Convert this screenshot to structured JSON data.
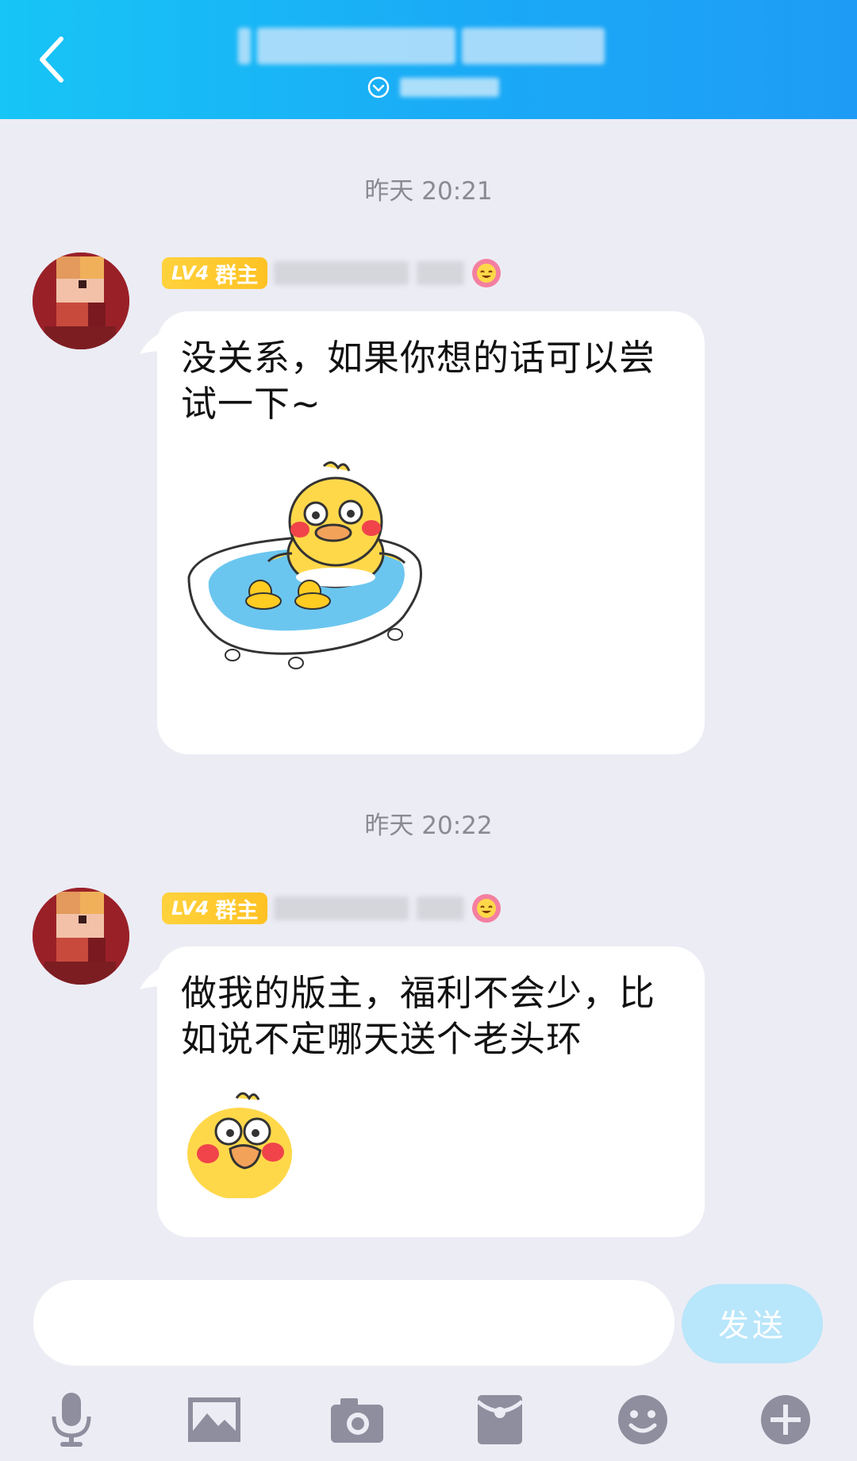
{
  "header": {
    "back_icon": "chevron-left-icon",
    "title": "",
    "subtitle": "",
    "expand_icon": "chevron-down-circle-icon",
    "bg_color": "#1aaaf6"
  },
  "messages": [
    {
      "time": "昨天 20:21",
      "badge_level": "LV4",
      "badge_role": "群主",
      "text": "没关系，如果你想的话可以尝试一下~",
      "sticker": "duck-in-bathtub-sticker"
    },
    {
      "time": "昨天 20:22",
      "badge_level": "LV4",
      "badge_role": "群主",
      "text": "做我的版主，福利不会少，比如说不定哪天送个老头环",
      "sticker": "duck-face-sticker"
    }
  ],
  "composer": {
    "input_value": "",
    "send_label": "发送",
    "send_color": "#b8e6fa"
  },
  "toolbar": {
    "icons": [
      "microphone-icon",
      "image-icon",
      "camera-icon",
      "red-packet-icon",
      "emoji-icon",
      "plus-icon"
    ]
  }
}
